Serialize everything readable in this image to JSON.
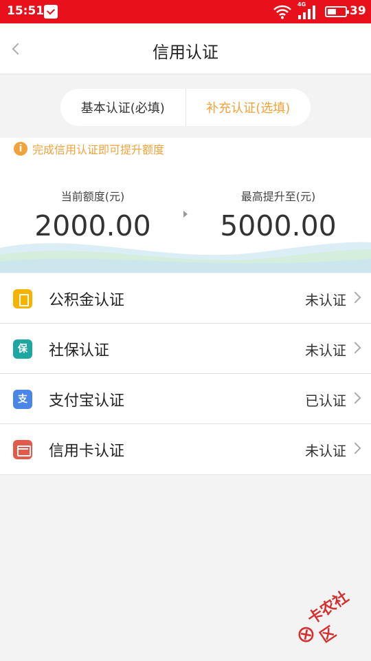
{
  "status_bar": {
    "time": "15:51",
    "network": "4G",
    "battery_level": "39"
  },
  "nav": {
    "title": "信用认证"
  },
  "tabs": [
    {
      "label": "基本认证(必填)"
    },
    {
      "label": "补充认证(选填)"
    }
  ],
  "tip": {
    "text": "完成信用认证即可提升额度"
  },
  "credit": {
    "current_label": "当前额度(元)",
    "current_value": "2000.00",
    "max_label": "最高提升至(元)",
    "max_value": "5000.00"
  },
  "items": [
    {
      "label": "公积金认证",
      "status": "未认证",
      "icon_text": "",
      "icon": "document-icon",
      "color": "#f4b400"
    },
    {
      "label": "社保认证",
      "status": "未认证",
      "icon_text": "保",
      "icon": "social-security-icon",
      "color": "#1ea7a0"
    },
    {
      "label": "支付宝认证",
      "status": "已认证",
      "icon_text": "支",
      "icon": "alipay-icon",
      "color": "#4a86e8"
    },
    {
      "label": "信用卡认证",
      "status": "未认证",
      "icon_text": "",
      "icon": "credit-card-icon",
      "color": "#e35a4a"
    }
  ],
  "watermark": {
    "text": "卡农社区"
  },
  "colors": {
    "status_bar": "#e8111b",
    "accent_orange": "#f1a23a"
  }
}
